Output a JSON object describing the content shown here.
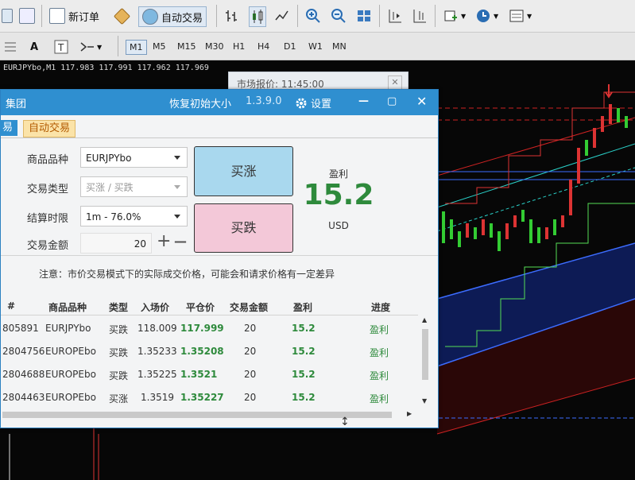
{
  "toolbar": {
    "new_order_label": "新订单",
    "auto_trading_label": "自动交易",
    "timeframes": [
      "M1",
      "M5",
      "M15",
      "M30",
      "H1",
      "H4",
      "D1",
      "W1",
      "MN"
    ],
    "active_timeframe": "M1"
  },
  "chart": {
    "symbol_line": "EURJPYbo,M1  117.983 117.991 117.962 117.969"
  },
  "quote_window": {
    "title": "市场报价: 11:45:00"
  },
  "panel": {
    "title": "集团",
    "restore_label": "恢复初始大小",
    "version": "1.3.9.0",
    "settings_label": "设置",
    "colors": {
      "titlebar": "#2f8fd0",
      "profit": "#2e8a3c",
      "call": "#a9d8ee",
      "put": "#f3c8d8"
    },
    "tabs": [
      {
        "label": "易"
      },
      {
        "label": "自动交易"
      }
    ],
    "form": {
      "symbol_label": "商品品种",
      "symbol_value": "EURJPYbo",
      "type_label": "交易类型",
      "type_value": "买涨 / 买跌",
      "expiry_label": "结算时限",
      "expiry_value": "1m - 76.0%",
      "amount_label": "交易金额",
      "amount_value": "20",
      "plus": "+",
      "minus": "—"
    },
    "call_button": "买涨",
    "put_button": "买跌",
    "profit_label": "盈利",
    "profit_value": "15.2",
    "profit_currency": "USD",
    "notice": "注意：市价交易模式下的实际成交价格，可能会和请求价格有一定差异",
    "table": {
      "headers": [
        "#",
        "商品品种",
        "类型",
        "入场价",
        "平仓价",
        "交易金额",
        "盈利",
        "进度"
      ],
      "rows": [
        {
          "id": "805891",
          "symbol": "EURJPYbo",
          "type": "买跌",
          "entry": "118.009",
          "close": "117.999",
          "amount": "20",
          "profit": "15.2",
          "progress": "盈利"
        },
        {
          "id": "2804756",
          "symbol": "EUROPEbo",
          "type": "买跌",
          "entry": "1.35233",
          "close": "1.35208",
          "amount": "20",
          "profit": "15.2",
          "progress": "盈利"
        },
        {
          "id": "2804688",
          "symbol": "EUROPEbo",
          "type": "买跌",
          "entry": "1.35225",
          "close": "1.3521",
          "amount": "20",
          "profit": "15.2",
          "progress": "盈利"
        },
        {
          "id": "2804463",
          "symbol": "EUROPEbo",
          "type": "买涨",
          "entry": "1.3519",
          "close": "1.35227",
          "amount": "20",
          "profit": "15.2",
          "progress": "盈利"
        }
      ]
    }
  }
}
